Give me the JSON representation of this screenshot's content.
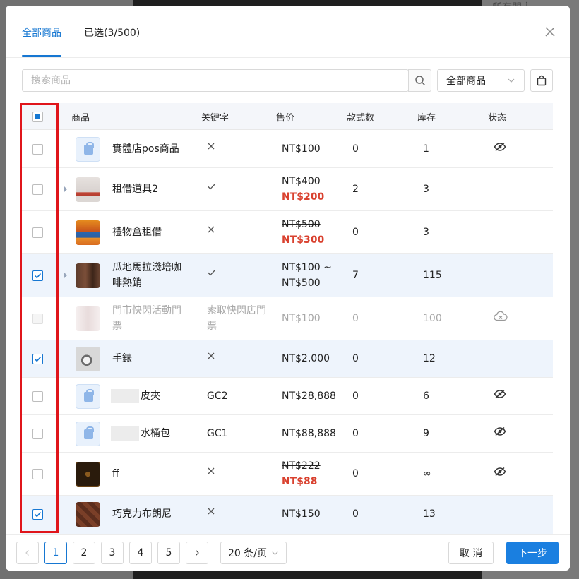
{
  "background": {
    "right_text": "所有門市"
  },
  "tabs": [
    {
      "label": "全部商品",
      "active": true
    },
    {
      "label": "已选(3/500)",
      "active": false
    }
  ],
  "search": {
    "placeholder": "搜索商品",
    "value": ""
  },
  "filter": {
    "selected": "全部商品"
  },
  "columns": {
    "product": "商品",
    "keyword": "关键字",
    "price": "售价",
    "styles": "款式数",
    "stock": "库存",
    "status": "状态"
  },
  "rows": [
    {
      "name": "實體店pos商品",
      "keyword_icon": "cross-icon",
      "price": "NT$100",
      "styles": "0",
      "stock": "1",
      "status_icon": "eye-hidden-icon",
      "checked": false
    },
    {
      "name": "租借道具2",
      "keyword_icon": "check-icon",
      "price_original": "NT$400",
      "price_sale": "NT$200",
      "styles": "2",
      "stock": "3",
      "checked": false,
      "expandable": true
    },
    {
      "name": "禮物盒租借",
      "keyword_icon": "cross-icon",
      "price_original": "NT$500",
      "price_sale": "NT$300",
      "styles": "0",
      "stock": "3",
      "checked": false
    },
    {
      "name": "瓜地馬拉淺培咖啡熱銷",
      "keyword_icon": "check-icon",
      "price": "NT$100 ~ NT$500",
      "styles": "7",
      "stock": "115",
      "checked": true,
      "expandable": true
    },
    {
      "name": "門市快閃活動門票",
      "keyword": "索取快閃店門票",
      "price": "NT$100",
      "styles": "0",
      "stock": "100",
      "status_icon": "cloud-cross-icon",
      "disabled": true
    },
    {
      "name": "手錶",
      "keyword_icon": "cross-icon",
      "price": "NT$2,000",
      "styles": "0",
      "stock": "12",
      "checked": true
    },
    {
      "name": "皮夾",
      "keyword": "GC2",
      "price": "NT$28,888",
      "styles": "0",
      "stock": "6",
      "status_icon": "eye-hidden-icon",
      "checked": false
    },
    {
      "name": "水桶包",
      "keyword": "GC1",
      "price": "NT$88,888",
      "styles": "0",
      "stock": "9",
      "status_icon": "eye-hidden-icon",
      "checked": false
    },
    {
      "name": "ff",
      "keyword_icon": "cross-icon",
      "price_original": "NT$222",
      "price_sale": "NT$88",
      "styles": "0",
      "stock": "∞",
      "status_icon": "eye-hidden-icon",
      "checked": false
    },
    {
      "name": "巧克力布朗尼",
      "keyword_icon": "cross-icon",
      "price": "NT$150",
      "styles": "0",
      "stock": "13",
      "checked": true
    }
  ],
  "pagination": {
    "pages": [
      "1",
      "2",
      "3",
      "4",
      "5"
    ],
    "current": "1",
    "page_size": "20 条/页"
  },
  "buttons": {
    "cancel": "取 消",
    "next": "下一步"
  },
  "colors": {
    "accent": "#1677d2",
    "sale": "#d9412f",
    "highlight_frame": "#e0151b"
  }
}
